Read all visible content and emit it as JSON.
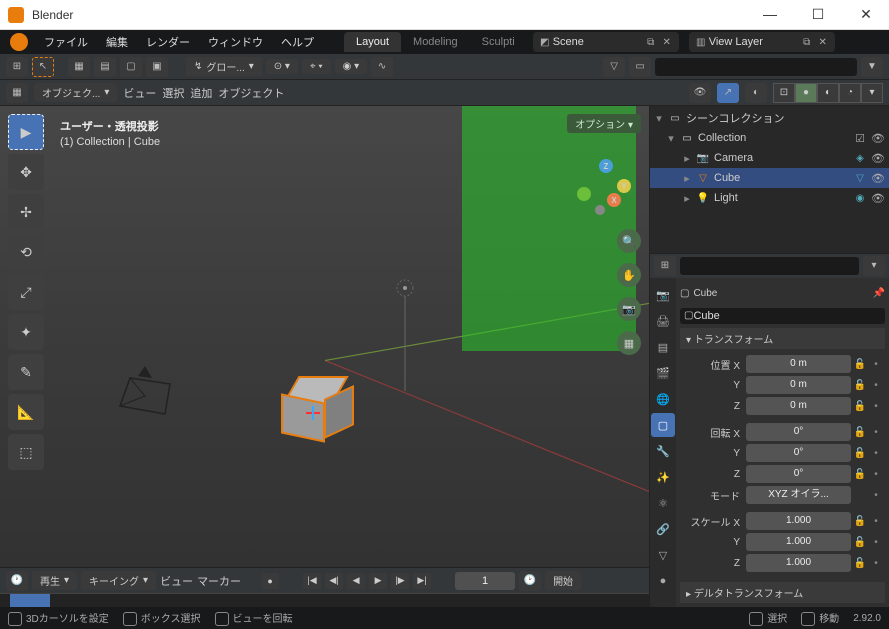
{
  "window": {
    "title": "Blender"
  },
  "winctrls": {
    "min": "—",
    "max": "☐",
    "close": "✕"
  },
  "menu": {
    "file": "ファイル",
    "edit": "編集",
    "render": "レンダー",
    "window": "ウィンドウ",
    "help": "ヘルプ"
  },
  "tabs": {
    "layout": "Layout",
    "modeling": "Modeling",
    "sculpting": "Sculpti"
  },
  "scene": {
    "name": "Scene"
  },
  "viewlayer": {
    "name": "View Layer"
  },
  "header2": {
    "glow": "グロー...",
    "objmode": "オブジェク...",
    "view": "ビュー",
    "select": "選択",
    "add": "追加",
    "object": "オブジェクト"
  },
  "viewport": {
    "info1": "ユーザー・透視投影",
    "info2": "(1) Collection | Cube",
    "options": "オプション"
  },
  "outliner": {
    "root": "シーンコレクション",
    "collection": "Collection",
    "camera": "Camera",
    "cube": "Cube",
    "light": "Light"
  },
  "props": {
    "item": "Cube",
    "name": "Cube",
    "transform": "トランスフォーム",
    "location": "位置",
    "rotation": "回転",
    "mode": "モード",
    "mode_val": "XYZ オイラ...",
    "scale": "スケール",
    "delta": "デルタトランスフォーム",
    "loc": {
      "x": "0 m",
      "y": "0 m",
      "z": "0 m"
    },
    "rot": {
      "x": "0°",
      "y": "0°",
      "z": "0°"
    },
    "scl": {
      "x": "1.000",
      "y": "1.000",
      "z": "1.000"
    },
    "ax": {
      "x": "X",
      "y": "Y",
      "z": "Z"
    }
  },
  "timeline": {
    "play": "再生",
    "keying": "キーイング",
    "view": "ビュー",
    "marker": "マーカー",
    "frame": "1",
    "start": "開始"
  },
  "status": {
    "cursor": "3Dカーソルを設定",
    "boxsel": "ボックス選択",
    "rotview": "ビューを回転",
    "select": "選択",
    "move": "移動",
    "version": "2.92.0"
  }
}
